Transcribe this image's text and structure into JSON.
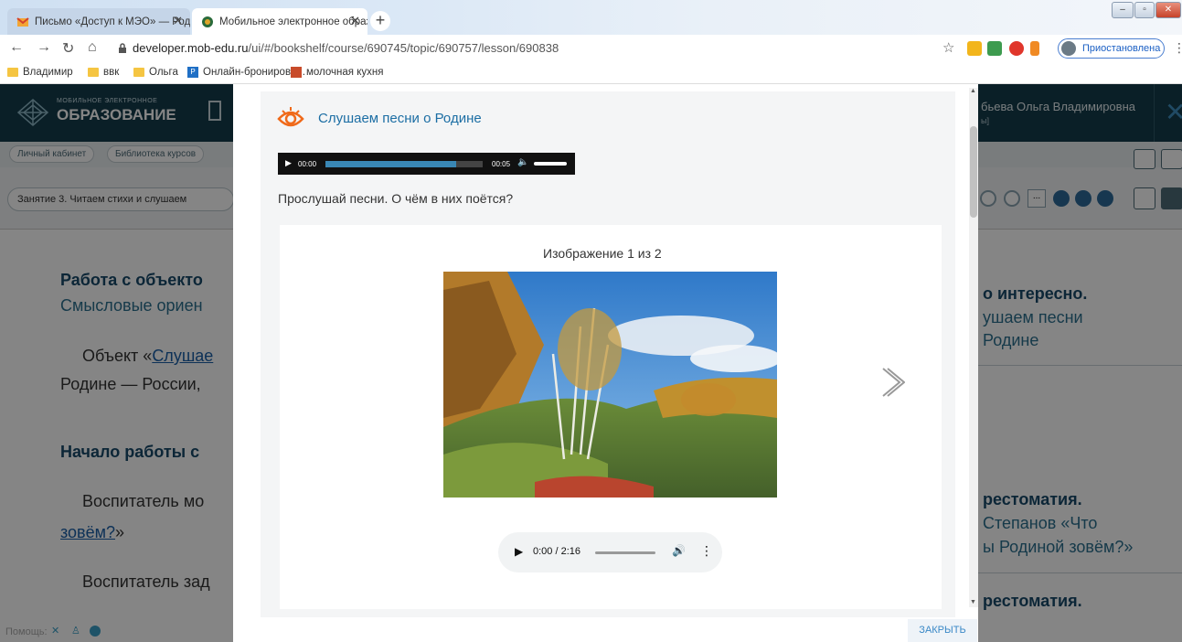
{
  "browser": {
    "tabs": [
      {
        "title": "Письмо «Доступ к МЭО» — Род",
        "close": "✕"
      },
      {
        "title": "Мобильное электронное образ",
        "close": "✕"
      }
    ],
    "url_host": "developer.mob-edu.ru",
    "url_path": "/ui/#/bookshelf/course/690745/topic/690757/lesson/690838",
    "paused_label": "Приостановлена",
    "bookmarks": [
      "Владимир",
      "ввк",
      "Ольга",
      "Онлайн-бронирова...",
      "молочная кухня"
    ]
  },
  "app": {
    "logo_top": "МОБИЛЬНОЕ ЭЛЕКТРОННОЕ",
    "logo_bottom": "ОБРАЗОВАНИЕ",
    "user_name": "бьева Ольга Владимировна",
    "user_sub": "ы]",
    "breadcrumbs": [
      "Личный кабинет",
      "Библиотека курсов"
    ],
    "lesson_title": "Занятие 3. Читаем стихи и слушаем",
    "help_label": "Помощь:"
  },
  "background": {
    "h1": "Работа с объекто",
    "sub1": "Смысловые ориен",
    "p1_prefix": "Объект «",
    "p1_link": "Слушае",
    "p1_line2": "Родине — России,",
    "h2": "Начало работы с",
    "p2": "Воспитатель мо",
    "p2_link": "зовём?",
    "p2_suffix": "»",
    "p3": "Воспитатель зад",
    "right_title": "о интересно.",
    "right_line1": "ушаем песни",
    "right_line2": "Родине",
    "right_title2": "рестоматия.",
    "right_line3": "Степанов «Что",
    "right_line4": "ы Родиной зовём?»",
    "right_title3": "рестоматия."
  },
  "modal": {
    "object_title": "Слушаем песни о Родине",
    "player1": {
      "time_current": "00:00",
      "time_total": "00:05",
      "progress": 0.83
    },
    "task": "Прослушай песни. О чём в них поётся?",
    "gallery_caption": "Изображение 1 из 2",
    "player2": {
      "time": "0:00 / 2:16"
    },
    "close_label": "ЗАКРЫТЬ"
  },
  "colors": {
    "header_bg": "#143d4c",
    "accent": "#1c6ea4",
    "eye_icon": "#f06a1a"
  }
}
